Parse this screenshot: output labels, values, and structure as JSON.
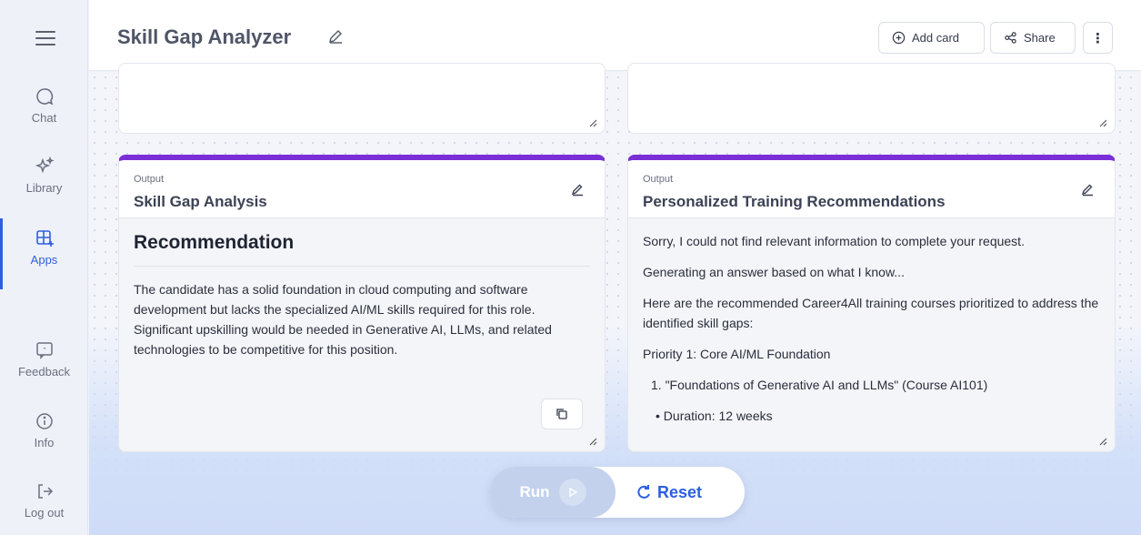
{
  "sidebar": {
    "items": [
      {
        "label": "Chat",
        "icon": "chat-bubble-icon"
      },
      {
        "label": "Library",
        "icon": "sparkles-icon"
      },
      {
        "label": "Apps",
        "icon": "apps-grid-icon",
        "active": true
      },
      {
        "label": "Feedback",
        "icon": "feedback-icon"
      },
      {
        "label": "Info",
        "icon": "info-icon"
      },
      {
        "label": "Log out",
        "icon": "logout-icon"
      }
    ]
  },
  "header": {
    "title": "Skill Gap Analyzer",
    "add_card_label": "Add card",
    "share_label": "Share",
    "more_label": "⋮"
  },
  "cards": {
    "left": {
      "kind": "Output",
      "title": "Skill Gap Analysis",
      "heading": "Recommendation",
      "text": "The candidate has a solid foundation in cloud computing and software development but lacks the specialized AI/ML skills required for this role. Significant upskilling would be needed in Generative AI, LLMs, and related technologies to be competitive for this position."
    },
    "right": {
      "kind": "Output",
      "title": "Personalized Training Recommendations",
      "lines": {
        "p1": "Sorry, I could not find relevant information to complete your request.",
        "p2": "Generating an answer based on what I know...",
        "p3": "Here are the recommended Career4All training courses prioritized to address the identified skill gaps:",
        "p4": "Priority 1: Core AI/ML Foundation",
        "li1": "1. \"Foundations of Generative AI and LLMs\" (Course AI101)",
        "b1": "• Duration: 12 weeks"
      }
    }
  },
  "controls": {
    "run_label": "Run",
    "reset_label": "Reset"
  },
  "colors": {
    "accent": "#2f5fe0",
    "card_top_border": "#7a2fd6"
  }
}
